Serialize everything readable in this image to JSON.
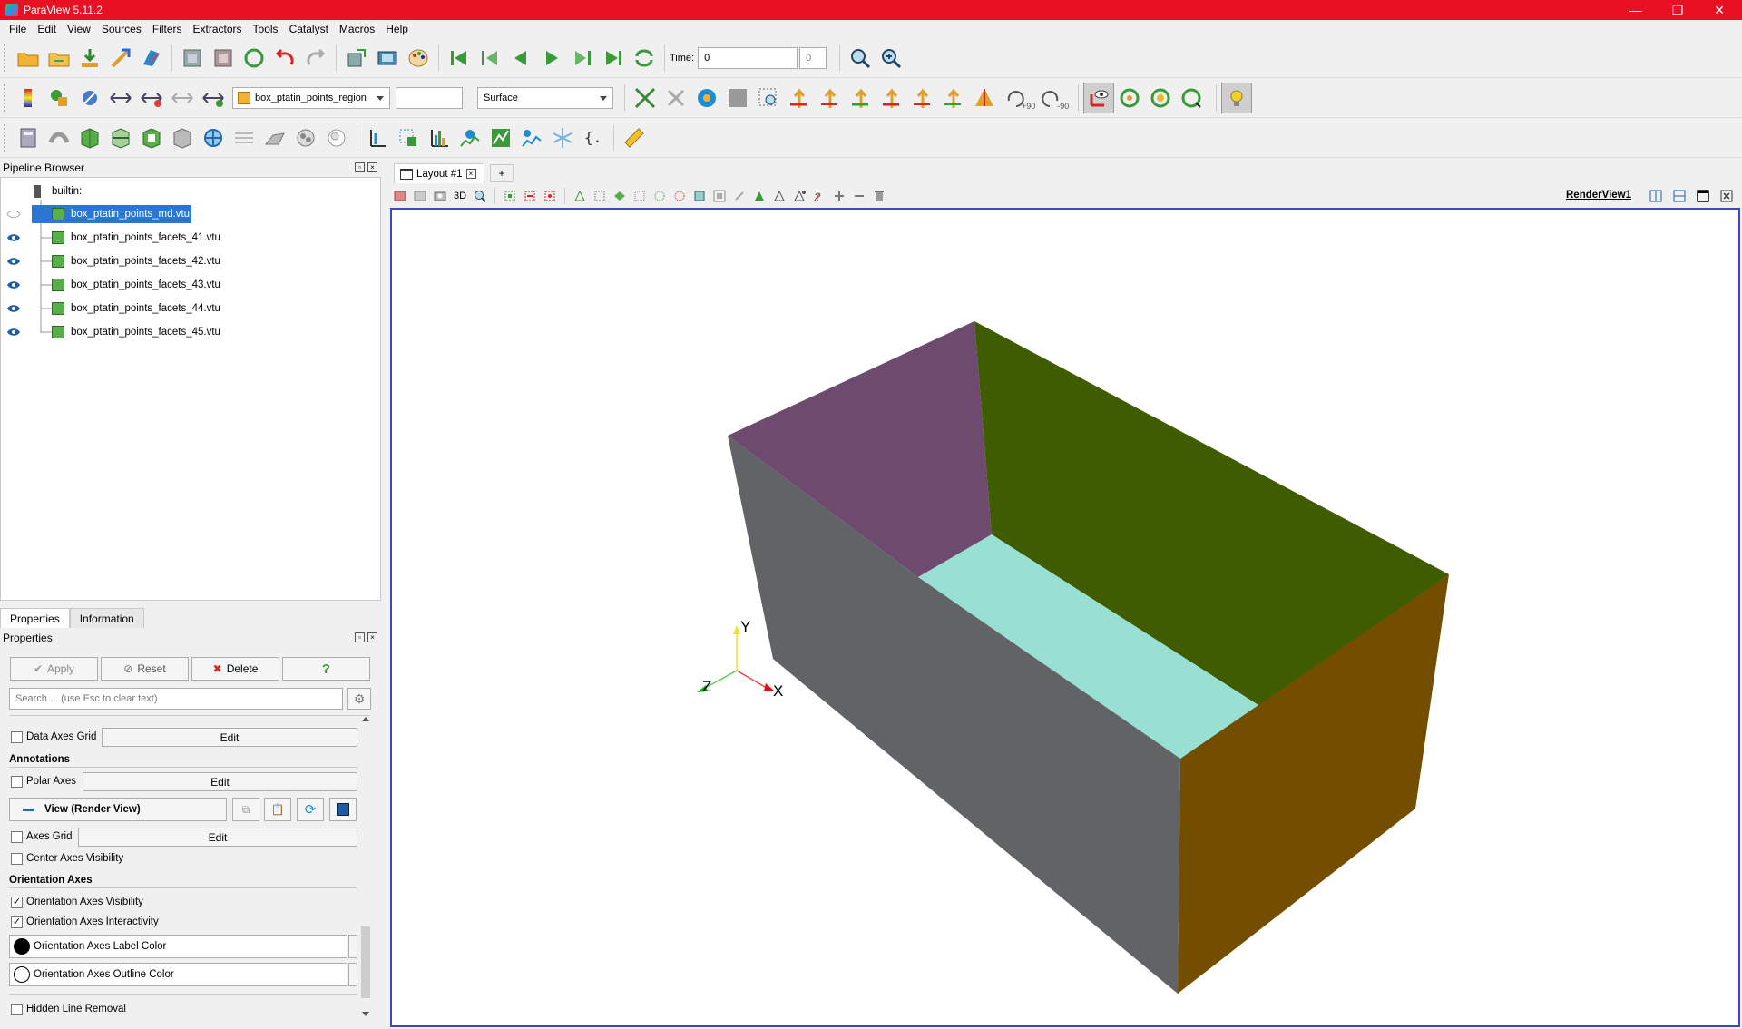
{
  "window": {
    "title": "ParaView 5.11.2",
    "controls": [
      "—",
      "❐",
      "✕"
    ]
  },
  "menu": [
    "File",
    "Edit",
    "View",
    "Sources",
    "Filters",
    "Extractors",
    "Tools",
    "Catalyst",
    "Macros",
    "Help"
  ],
  "toolbar1": {
    "time_label": "Time:",
    "time_value": "0",
    "time_index": "0"
  },
  "toolbar2": {
    "array_combo": "box_ptatin_points_region",
    "component_combo": "",
    "representation_combo": "Surface",
    "rotate_plus": "+90",
    "rotate_minus": "-90"
  },
  "toolbar2_axes": [
    "+X",
    "-X",
    "+Y",
    "-Y",
    "+Z",
    "-Z"
  ],
  "pipeline": {
    "title": "Pipeline Browser",
    "root": "builtin:",
    "items": [
      {
        "label": "box_ptatin_points_md.vtu",
        "selected": true,
        "visible": false
      },
      {
        "label": "box_ptatin_points_facets_41.vtu",
        "visible": true
      },
      {
        "label": "box_ptatin_points_facets_42.vtu",
        "visible": true
      },
      {
        "label": "box_ptatin_points_facets_43.vtu",
        "visible": true
      },
      {
        "label": "box_ptatin_points_facets_44.vtu",
        "visible": true
      },
      {
        "label": "box_ptatin_points_facets_45.vtu",
        "visible": true
      }
    ]
  },
  "tabs": [
    "Properties",
    "Information"
  ],
  "properties": {
    "title": "Properties",
    "apply": "Apply",
    "reset": "Reset",
    "delete": "Delete",
    "help": "?",
    "search_placeholder": "Search ... (use Esc to clear text)",
    "data_axes_grid": "Data Axes Grid",
    "edit": "Edit",
    "annotations": "Annotations",
    "polar_axes": "Polar Axes",
    "view_section": "View (Render View)",
    "axes_grid": "Axes Grid",
    "center_axes": "Center Axes Visibility",
    "orientation_axes": "Orientation Axes",
    "oa_visibility": "Orientation Axes Visibility",
    "oa_interactivity": "Orientation Axes Interactivity",
    "oa_label_color": "Orientation Axes Label Color",
    "oa_outline_color": "Orientation Axes Outline Color",
    "hidden_line": "Hidden Line Removal"
  },
  "layout": {
    "tab": "Layout #1",
    "add": "+",
    "view_name": "RenderView1",
    "mode_3d": "3D"
  },
  "axes": {
    "x": "X",
    "y": "Y",
    "z": "Z"
  },
  "colors": {
    "purple": "#6e4a6f",
    "green": "#3f5c00",
    "cyan": "#98e0d3",
    "gray": "#626366",
    "orange": "#734e00",
    "accent": "#3b46c8",
    "title_red": "#e81123"
  }
}
